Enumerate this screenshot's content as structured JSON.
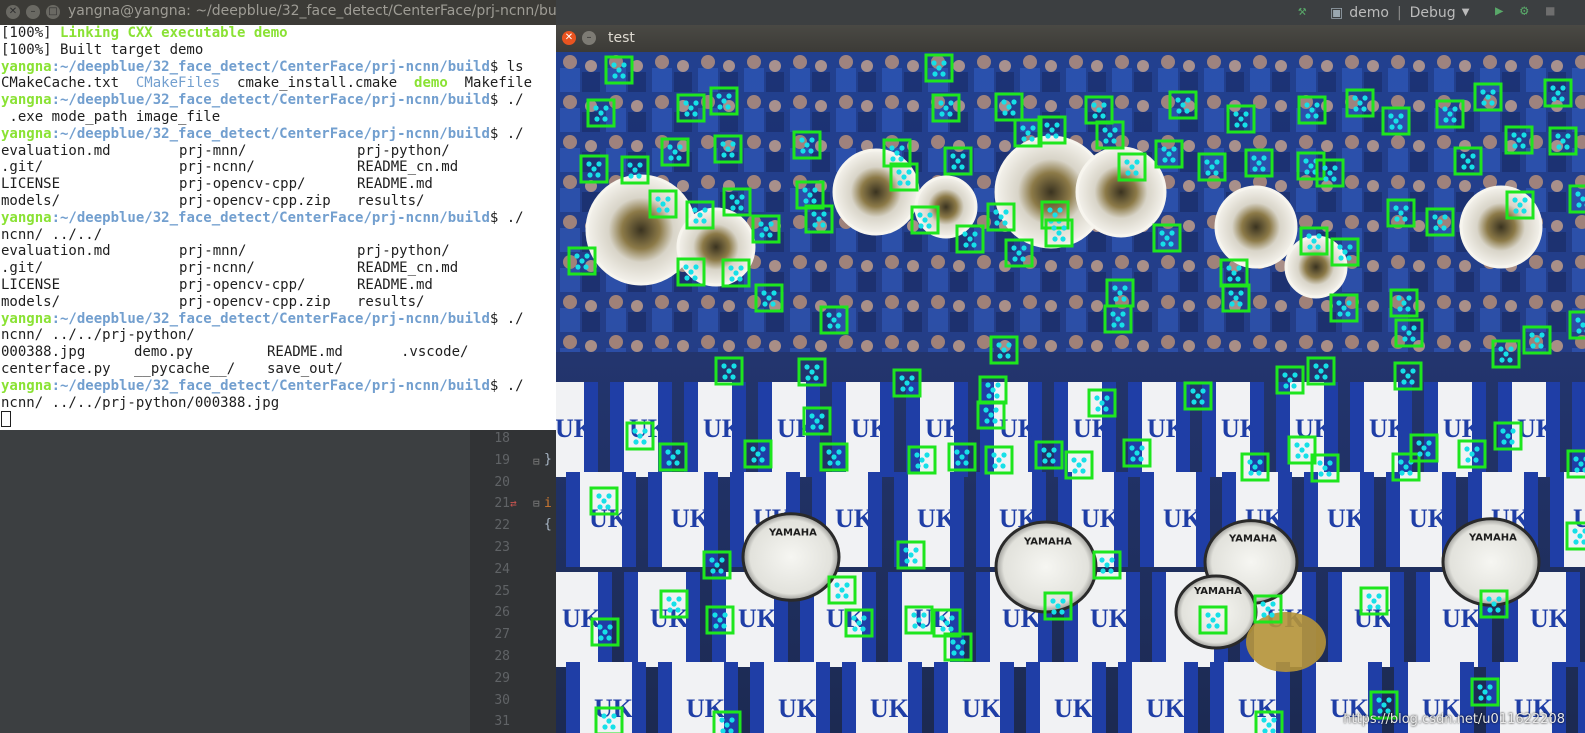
{
  "terminal": {
    "title": "yangna@yangna: ~/deepblue/32_face_detect/CenterFace/prj-ncnn/build",
    "prompt_user": "yangna",
    "prompt_path": ":~/deepblue/32_face_detect/CenterFace/prj-ncnn/build",
    "lines": [
      {
        "kind": "build",
        "prefix": "[100%] ",
        "text": "Linking CXX executable demo"
      },
      {
        "kind": "plain",
        "text": "[100%] Built target demo"
      },
      {
        "kind": "prompt",
        "cmd": "$ ls"
      },
      {
        "kind": "lsbuild",
        "items": [
          "CMakeCache.txt",
          "CMakeFiles",
          "cmake_install.cmake",
          "demo",
          "Makefile"
        ]
      },
      {
        "kind": "prompt",
        "cmd": "$ ./"
      },
      {
        "kind": "plain",
        "text": " .exe mode_path image_file"
      },
      {
        "kind": "prompt",
        "cmd": "$ ./"
      },
      {
        "kind": "cols3",
        "items": [
          "evaluation.md",
          "prj-mnn/",
          "prj-python/"
        ]
      },
      {
        "kind": "cols3",
        "items": [
          ".git/",
          "prj-ncnn/",
          "README_cn.md"
        ]
      },
      {
        "kind": "cols3",
        "items": [
          "LICENSE",
          "prj-opencv-cpp/",
          "README.md"
        ]
      },
      {
        "kind": "cols3",
        "items": [
          "models/",
          "prj-opencv-cpp.zip",
          "results/"
        ]
      },
      {
        "kind": "prompt",
        "cmd": "$ ./"
      },
      {
        "kind": "plain",
        "text": "ncnn/ ../../"
      },
      {
        "kind": "cols3",
        "items": [
          "evaluation.md",
          "prj-mnn/",
          "prj-python/"
        ]
      },
      {
        "kind": "cols3",
        "items": [
          ".git/",
          "prj-ncnn/",
          "README_cn.md"
        ]
      },
      {
        "kind": "cols3",
        "items": [
          "LICENSE",
          "prj-opencv-cpp/",
          "README.md"
        ]
      },
      {
        "kind": "cols3",
        "items": [
          "models/",
          "prj-opencv-cpp.zip",
          "results/"
        ]
      },
      {
        "kind": "prompt",
        "cmd": "$ ./"
      },
      {
        "kind": "plain",
        "text": "ncnn/ ../../prj-python/"
      },
      {
        "kind": "cols4",
        "items": [
          "000388.jpg",
          "demo.py",
          "README.md",
          ".vscode/"
        ]
      },
      {
        "kind": "cols4",
        "items": [
          "centerface.py",
          "__pycache__/",
          "save_out/",
          ""
        ]
      },
      {
        "kind": "prompt",
        "cmd": "$ ./"
      },
      {
        "kind": "plain",
        "text": "ncnn/ ../../prj-python/000388.jpg"
      }
    ]
  },
  "ide": {
    "run_config": "demo",
    "build_type": "Debug",
    "line_numbers": [
      "18",
      "19",
      "20",
      "21",
      "22",
      "23",
      "24",
      "25",
      "26",
      "27",
      "28",
      "29",
      "30",
      "31"
    ]
  },
  "viewer": {
    "title": "test",
    "watermark": "https://blog.csdn.net/u011622208",
    "box_color": "#1ee61e",
    "landmark_color": "#16e0e8"
  }
}
